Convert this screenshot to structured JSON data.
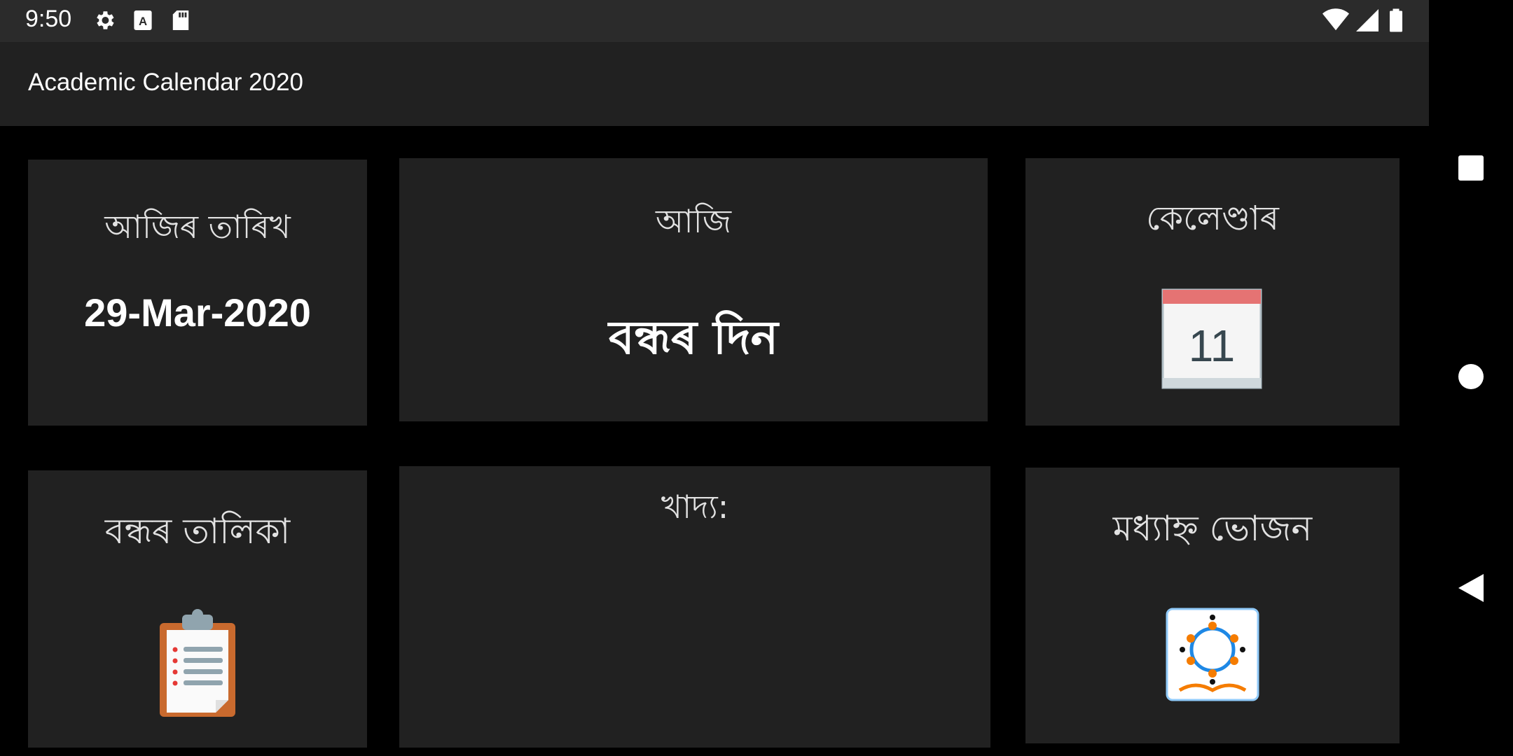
{
  "status_bar": {
    "time": "9:50",
    "left_icons": [
      "gear-icon",
      "font-a-icon",
      "sd-card-icon"
    ],
    "right_icons": [
      "wifi-icon",
      "signal-icon",
      "battery-icon"
    ]
  },
  "app_bar": {
    "title": "Academic Calendar 2020"
  },
  "cards": {
    "today_date": {
      "title": "আজিৰ তাৰিখ",
      "value": "29-Mar-2020"
    },
    "today": {
      "title": "আজি",
      "value": "বন্ধৰ দিন"
    },
    "calendar": {
      "title": "কেলেণ্ডাৰ",
      "icon": "calendar-icon",
      "icon_number": "11"
    },
    "holiday_list": {
      "title": "বন্ধৰ তালিকা",
      "icon": "clipboard-icon"
    },
    "food": {
      "title": "খাদ্য:"
    },
    "midday_meal": {
      "title": "মধ্যাহ্ন ভোজন",
      "icon": "midday-meal-logo-icon"
    }
  },
  "nav_bar": {
    "buttons": [
      "recents-button",
      "home-button",
      "back-button"
    ]
  },
  "colors": {
    "background": "#000000",
    "card": "#212121",
    "app_bar": "#212121",
    "status_bar": "#2b2b2b",
    "text": "#e2e2e2"
  }
}
